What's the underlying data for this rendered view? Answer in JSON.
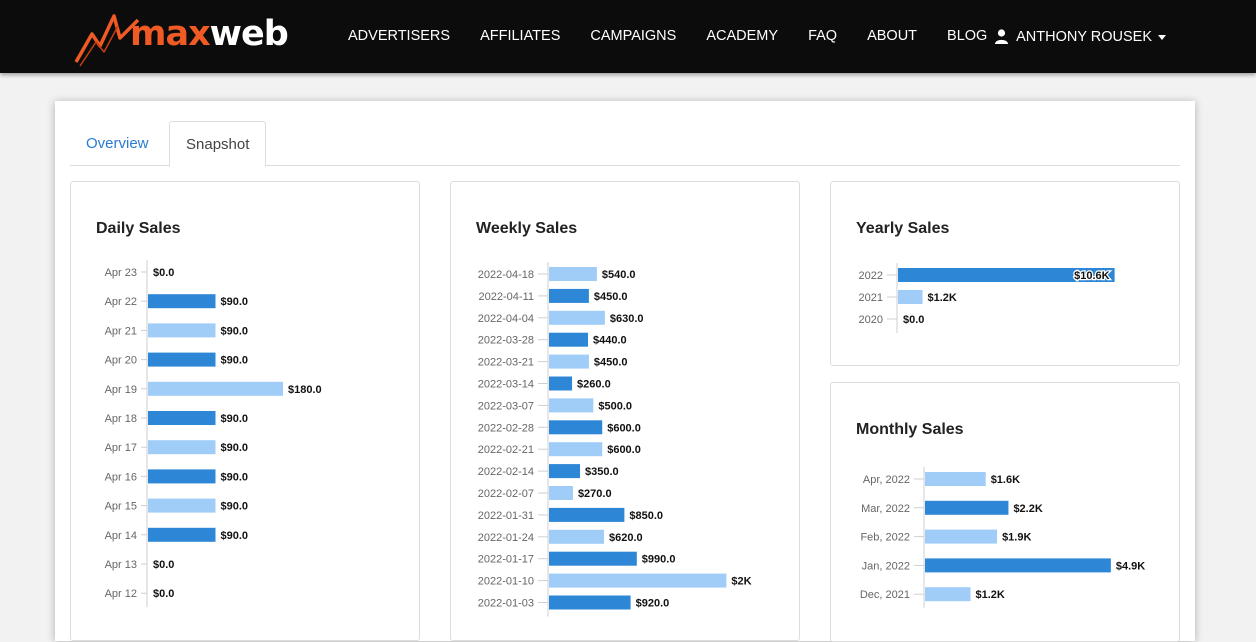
{
  "brand": {
    "logo_max": "max",
    "logo_web": "web"
  },
  "nav": {
    "items": [
      "ADVERTISERS",
      "AFFILIATES",
      "CAMPAIGNS",
      "ACADEMY",
      "FAQ",
      "ABOUT",
      "BLOG"
    ]
  },
  "user": {
    "name": "ANTHONY ROUSEK"
  },
  "tabs": {
    "overview": "Overview",
    "snapshot": "Snapshot"
  },
  "colors": {
    "dark_bar": "#2d87d6",
    "light_bar": "#9fcdf8",
    "accent": "#f05a24",
    "link": "#2a7bd1"
  },
  "chart_data": [
    {
      "id": "daily",
      "type": "bar",
      "orientation": "horizontal",
      "title": "Daily Sales",
      "categories": [
        "Apr 23",
        "Apr 22",
        "Apr 21",
        "Apr 20",
        "Apr 19",
        "Apr 18",
        "Apr 17",
        "Apr 16",
        "Apr 15",
        "Apr 14",
        "Apr 13",
        "Apr 12"
      ],
      "values": [
        0,
        90,
        90,
        90,
        180,
        90,
        90,
        90,
        90,
        90,
        0,
        0
      ],
      "labels": [
        "$0.0",
        "$90.0",
        "$90.0",
        "$90.0",
        "$180.0",
        "$90.0",
        "$90.0",
        "$90.0",
        "$90.0",
        "$90.0",
        "$0.0",
        "$0.0"
      ],
      "xlim": [
        0,
        360
      ]
    },
    {
      "id": "weekly",
      "type": "bar",
      "orientation": "horizontal",
      "title": "Weekly Sales",
      "categories": [
        "2022-04-18",
        "2022-04-11",
        "2022-04-04",
        "2022-03-28",
        "2022-03-21",
        "2022-03-14",
        "2022-03-07",
        "2022-02-28",
        "2022-02-21",
        "2022-02-14",
        "2022-02-07",
        "2022-01-31",
        "2022-01-24",
        "2022-01-17",
        "2022-01-10",
        "2022-01-03"
      ],
      "values": [
        540,
        450,
        630,
        440,
        450,
        260,
        500,
        600,
        600,
        350,
        270,
        850,
        620,
        990,
        2000,
        920
      ],
      "labels": [
        "$540.0",
        "$450.0",
        "$630.0",
        "$440.0",
        "$450.0",
        "$260.0",
        "$500.0",
        "$600.0",
        "$600.0",
        "$350.0",
        "$270.0",
        "$850.0",
        "$620.0",
        "$990.0",
        "$2K",
        "$920.0"
      ],
      "xlim": [
        0,
        2255
      ]
    },
    {
      "id": "yearly",
      "type": "bar",
      "orientation": "horizontal",
      "title": "Yearly Sales",
      "categories": [
        "2022",
        "2021",
        "2020"
      ],
      "values": [
        10600,
        1200,
        0
      ],
      "labels": [
        "$10.6K",
        "$1.2K",
        "$0.0"
      ],
      "xlim": [
        0,
        11500
      ]
    },
    {
      "id": "monthly",
      "type": "bar",
      "orientation": "horizontal",
      "title": "Monthly Sales",
      "categories": [
        "Apr, 2022",
        "Mar, 2022",
        "Feb, 2022",
        "Jan, 2022",
        "Dec, 2021"
      ],
      "values": [
        1600,
        2200,
        1900,
        4900,
        1200
      ],
      "labels": [
        "$1.6K",
        "$2.2K",
        "$1.9K",
        "$4.9K",
        "$1.2K"
      ],
      "xlim": [
        0,
        5800
      ]
    }
  ]
}
